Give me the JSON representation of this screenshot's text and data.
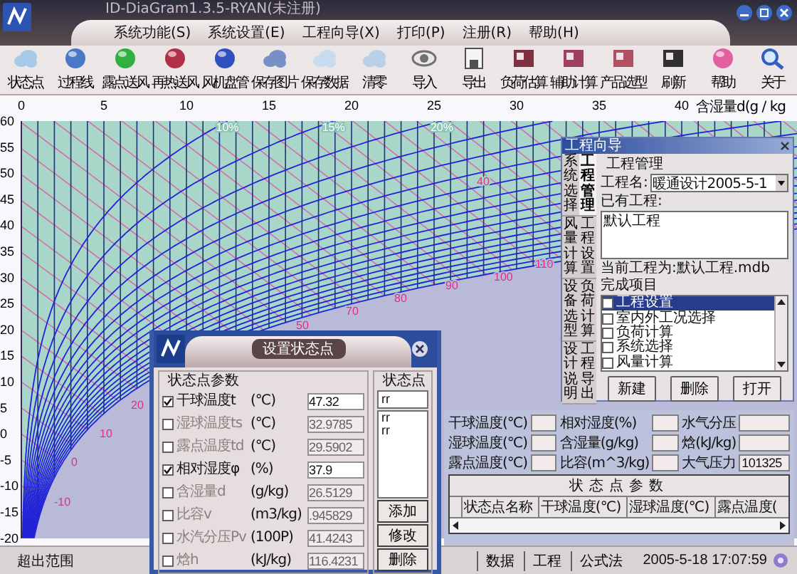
{
  "window": {
    "title": "ID-DiaGram1.3.5-RYAN(未注册)"
  },
  "menu": [
    "系统功能(S)",
    "系统设置(E)",
    "工程向导(X)",
    "打印(P)",
    "注册(R)",
    "帮助(H)"
  ],
  "toolbar": [
    {
      "label": "状态点",
      "kind": "cloud",
      "color": "#a8c8e8"
    },
    {
      "label": "过程线",
      "kind": "ball",
      "color": "#4a78c8"
    },
    {
      "label": "露点送风",
      "kind": "ball",
      "color": "#30b040"
    },
    {
      "label": "再热送风",
      "kind": "ball",
      "color": "#b03048"
    },
    {
      "label": "风机盘管",
      "kind": "ball",
      "color": "#3050c0"
    },
    {
      "label": "保存图片",
      "kind": "cloud",
      "color": "#7890c8"
    },
    {
      "label": "保存数据",
      "kind": "cloud",
      "color": "#c8dcf0"
    },
    {
      "label": "清零",
      "kind": "cloud",
      "color": "#b8d0e8"
    },
    {
      "label": "导入",
      "kind": "eye",
      "color": "#707070"
    },
    {
      "label": "导出",
      "kind": "disk",
      "color": "#505050"
    },
    {
      "label": "负荷估算",
      "kind": "cabinet",
      "color": "#803040"
    },
    {
      "label": "辅助计算",
      "kind": "cabinet",
      "color": "#a04060"
    },
    {
      "label": "产品选型",
      "kind": "cabinet",
      "color": "#b05060"
    },
    {
      "label": "刷新",
      "kind": "cabinet",
      "color": "#303030"
    },
    {
      "label": "帮助",
      "kind": "ball",
      "color": "#e060a0"
    },
    {
      "label": "关于",
      "kind": "search",
      "color": "#3060c0"
    }
  ],
  "chart": {
    "x_ticks": [
      "0",
      "5",
      "10",
      "15",
      "20",
      "25",
      "30",
      "35",
      "40"
    ],
    "x_title": "含湿量d(g / kg",
    "y_ticks": [
      "60",
      "55",
      "50",
      "45",
      "40",
      "35",
      "30",
      "25",
      "20",
      "15",
      "10",
      "5",
      "0",
      "-5",
      "-10",
      "-15",
      "-20"
    ],
    "humidity_labels": [
      "10%",
      "15%",
      "20%"
    ],
    "enthalpy_labels": [
      "40",
      "110",
      "100",
      "90",
      "80",
      "70",
      "50",
      "20",
      "10",
      "0",
      "-10"
    ]
  },
  "project_panel": {
    "title": "工程向导",
    "tab_columns": [
      {
        "tabs": [
          {
            "label": "系统选择",
            "selected": false
          },
          {
            "label": "风量计算",
            "selected": false
          },
          {
            "label": "设备选型",
            "selected": false
          },
          {
            "label": "设计说明",
            "selected": false
          }
        ]
      },
      {
        "tabs": [
          {
            "label": "工程管理",
            "selected": true
          },
          {
            "label": "工程设置",
            "selected": false
          },
          {
            "label": "负荷计算",
            "selected": false
          },
          {
            "label": "工程导出",
            "selected": false
          }
        ]
      }
    ],
    "group_title": "工程管理",
    "name_label": "工程名:",
    "name_value": "暖通设计2005-5-1",
    "existing_label": "已有工程:",
    "existing": [
      "默认工程"
    ],
    "current": "当前工程为:默认工程.mdb",
    "items_label": "完成项目",
    "items": [
      {
        "label": "工程设置",
        "checked": false,
        "selected": true
      },
      {
        "label": "室内外工况选择",
        "checked": false,
        "selected": false
      },
      {
        "label": "负荷计算",
        "checked": false,
        "selected": false
      },
      {
        "label": "系统选择",
        "checked": false,
        "selected": false
      },
      {
        "label": "风量计算",
        "checked": false,
        "selected": false
      }
    ],
    "buttons": [
      "新建",
      "删除",
      "打开"
    ]
  },
  "results": {
    "fields": [
      {
        "label": "干球温度(℃)"
      },
      {
        "label": "相对湿度(%)"
      },
      {
        "label": "水气分压"
      },
      {
        "label": "湿球温度(℃)"
      },
      {
        "label": "含湿量(g/kg)"
      },
      {
        "label": "焓(kJ/kg)"
      },
      {
        "label": "露点温度(℃)"
      },
      {
        "label": "比容(m^3/kg)"
      },
      {
        "label": "大气压力",
        "value": "101325"
      }
    ],
    "table": {
      "title": "状态点参数",
      "columns": [
        "状态点名称",
        "干球温度(℃)",
        "湿球温度(℃)",
        "露点温度("
      ]
    }
  },
  "state_dialog": {
    "title": "设置状态点",
    "params_title": "状态点参数",
    "params": [
      {
        "label": "干球温度t",
        "unit": "(℃)",
        "value": "47.32",
        "checked": true
      },
      {
        "label": "湿球温度ts",
        "unit": "(℃)",
        "value": "32.9785",
        "checked": false
      },
      {
        "label": "露点温度td",
        "unit": "(℃)",
        "value": "29.5902",
        "checked": false
      },
      {
        "label": "相对湿度φ",
        "unit": "(%)",
        "value": "37.9",
        "checked": true
      },
      {
        "label": "含湿量d",
        "unit": "(g/kg)",
        "value": "26.5129",
        "checked": false
      },
      {
        "label": "比容v",
        "unit": "(m3/kg)",
        "value": ".945829",
        "checked": false
      },
      {
        "label": "水汽分压Pv",
        "unit": "(100P)",
        "value": "41.4243",
        "checked": false
      },
      {
        "label": "焓h",
        "unit": "(kJ/kg)",
        "value": "116.4231",
        "checked": false
      }
    ],
    "points_title": "状态点",
    "point_name": "rr",
    "points": [
      "rr",
      "rr"
    ],
    "buttons": [
      "添加",
      "修改",
      "删除"
    ]
  },
  "status_bar": {
    "message": "超出范围",
    "tabs": [
      "数据",
      "工程",
      "公式法"
    ],
    "datetime": "2005-5-18 17:07:59"
  }
}
